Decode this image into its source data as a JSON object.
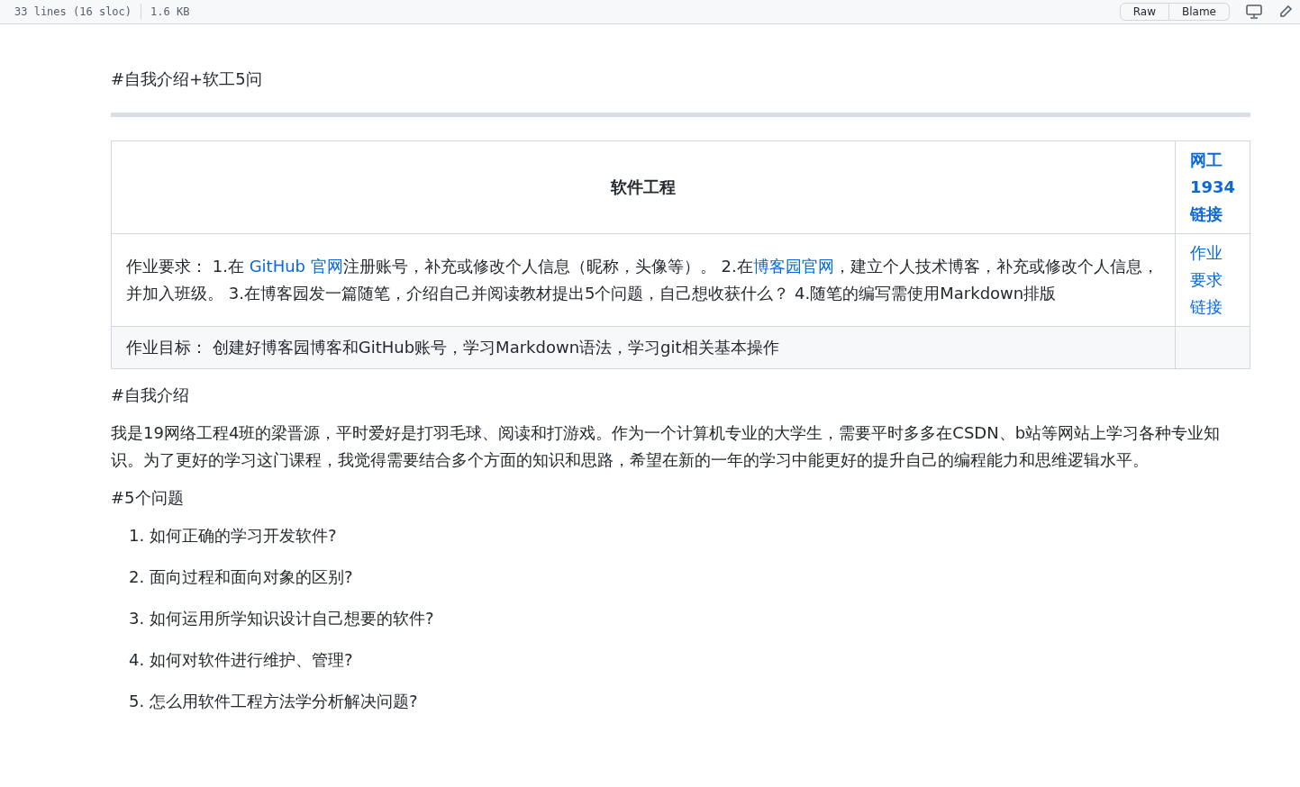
{
  "file_bar": {
    "lines": "33 lines (16 sloc)",
    "size": "1.6 KB",
    "buttons": [
      "Raw",
      "Blame"
    ]
  },
  "heading_top": "#自我介绍+软工5问",
  "table": {
    "header": [
      {
        "text": "软件工程",
        "link": false
      },
      {
        "text": "网工1934链接",
        "link": true
      }
    ],
    "rows": [
      {
        "cells": [
          {
            "parts": [
              {
                "text": "作业要求： 1.在 ",
                "link": false
              },
              {
                "text": "GitHub 官网",
                "link": true
              },
              {
                "text": "注册账号，补充或修改个人信息（昵称，头像等）。 2.在",
                "link": false
              },
              {
                "text": "博客园官网",
                "link": true
              },
              {
                "text": "，建立个人技术博客，补充或修改个人信息，并加入班级。 3.在博客园发一篇随笔，介绍自己并阅读教材提出5个问题，自己想收获什么？ 4.随笔的编写需使用Markdown排版",
                "link": false
              }
            ]
          },
          {
            "parts": [
              {
                "text": "作业要求链接",
                "link": true
              }
            ]
          }
        ]
      },
      {
        "cells": [
          {
            "parts": [
              {
                "text": "作业目标： 创建好博客园博客和GitHub账号，学习Markdown语法，学习git相关基本操作",
                "link": false
              }
            ]
          },
          {}
        ]
      }
    ]
  },
  "heading_intro": "#自我介绍",
  "intro": "我是19网络工程4班的梁晋源，平时爱好是打羽毛球、阅读和打游戏。作为一个计算机专业的大学生，需要平时多多在CSDN、b站等网站上学习各种专业知识。为了更好的学习这门课程，我觉得需要结合多个方面的知识和思路，希望在新的一年的学习中能更好的提升自己的编程能力和思维逻辑水平。",
  "heading_questions": "#5个问题",
  "questions": [
    {
      "number": "1.",
      "text": "如何正确的学习开发软件?"
    },
    {
      "number": "2.",
      "text": "面向过程和面向对象的区别?"
    },
    {
      "number": "3.",
      "text": "如何运用所学知识设计自己想要的软件?"
    },
    {
      "number": "4.",
      "text": "如何对软件进行维护、管理?"
    },
    {
      "number": "5.",
      "text": "怎么用软件工程方法学分析解决问题?"
    }
  ]
}
